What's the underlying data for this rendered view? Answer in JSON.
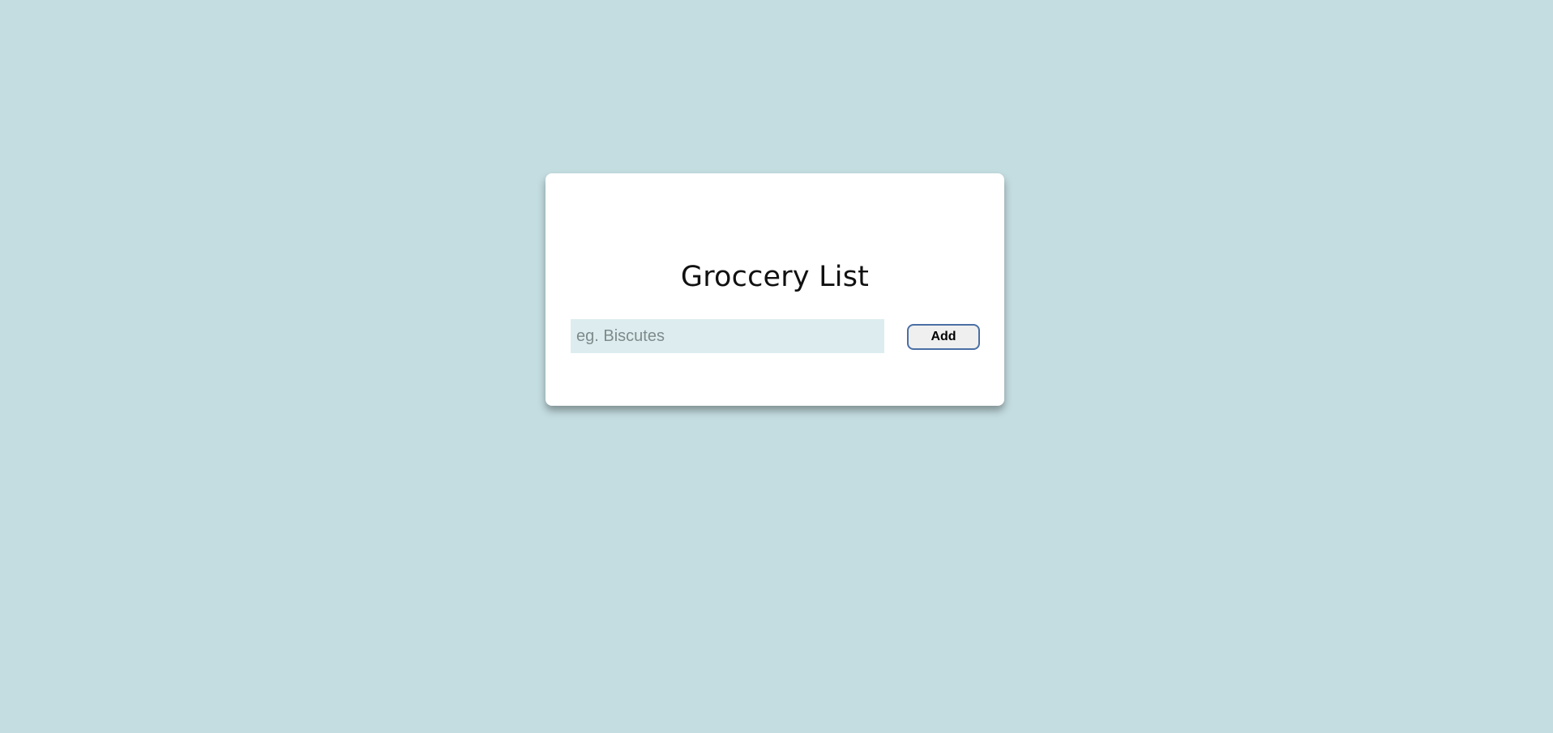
{
  "app": {
    "title": "Groccery List"
  },
  "form": {
    "input_placeholder": "eg. Biscutes",
    "input_value": "",
    "add_label": "Add"
  },
  "colors": {
    "background": "#c4dde1",
    "card": "#ffffff",
    "input_background": "#ddedef",
    "button_border": "#4a6fa5"
  }
}
